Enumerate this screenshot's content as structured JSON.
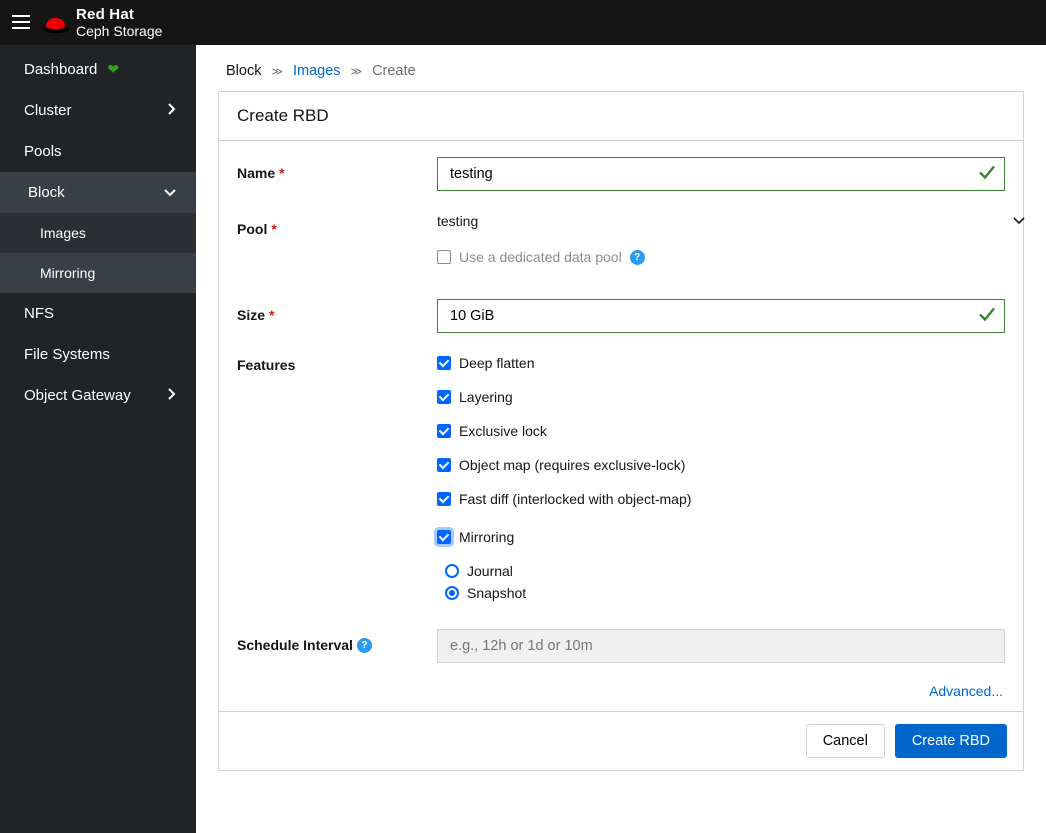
{
  "brand": {
    "line1": "Red Hat",
    "line2": "Ceph Storage"
  },
  "sidebar": {
    "items": [
      {
        "label": "Dashboard",
        "icon": "heartbeat"
      },
      {
        "label": "Cluster",
        "chevron": "right"
      },
      {
        "label": "Pools"
      },
      {
        "label": "Block",
        "chevron": "down",
        "open": true,
        "children": [
          {
            "label": "Images",
            "active": true
          },
          {
            "label": "Mirroring"
          }
        ]
      },
      {
        "label": "NFS"
      },
      {
        "label": "File Systems"
      },
      {
        "label": "Object Gateway",
        "chevron": "right"
      }
    ]
  },
  "breadcrumb": {
    "root": "Block",
    "link": "Images",
    "current": "Create"
  },
  "panel": {
    "title": "Create RBD"
  },
  "form": {
    "name": {
      "label": "Name",
      "value": "testing",
      "required": true,
      "valid": true
    },
    "pool": {
      "label": "Pool",
      "value": "testing",
      "required": true
    },
    "dedicated": {
      "label": "Use a dedicated data pool",
      "checked": false
    },
    "size": {
      "label": "Size",
      "value": "10 GiB",
      "required": true,
      "valid": true
    },
    "features": {
      "label": "Features",
      "items": [
        {
          "label": "Deep flatten",
          "checked": true
        },
        {
          "label": "Layering",
          "checked": true
        },
        {
          "label": "Exclusive lock",
          "checked": true
        },
        {
          "label": "Object map (requires exclusive-lock)",
          "checked": true
        },
        {
          "label": "Fast diff (interlocked with object-map)",
          "checked": true
        }
      ],
      "mirroring": {
        "label": "Mirroring",
        "checked": true,
        "modes": [
          {
            "label": "Journal",
            "selected": false
          },
          {
            "label": "Snapshot",
            "selected": true
          }
        ]
      }
    },
    "schedule": {
      "label": "Schedule Interval",
      "placeholder": "e.g., 12h or 1d or 10m"
    },
    "advanced": "Advanced...",
    "buttons": {
      "cancel": "Cancel",
      "submit": "Create RBD"
    }
  }
}
